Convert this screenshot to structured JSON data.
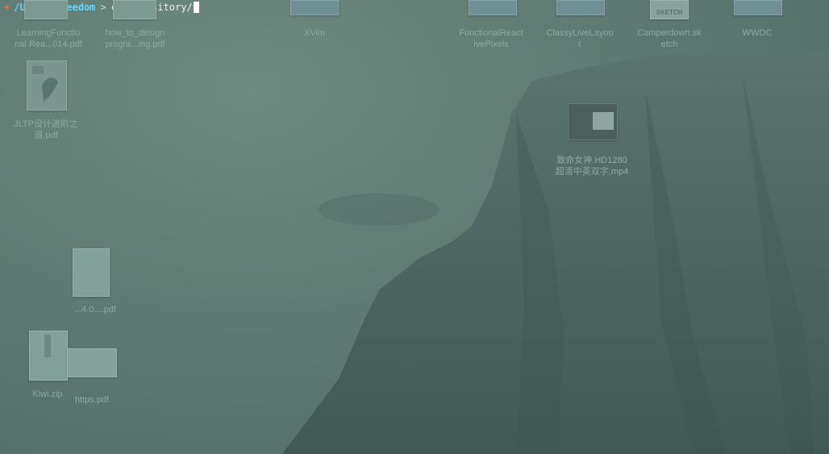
{
  "terminal": {
    "arrow": "➜",
    "path": "/Users/freedom",
    "separator": ">",
    "command": "cd Repository/"
  },
  "desktop_icons": [
    {
      "label": "LearningFunctio\nnal Rea...014.pdf"
    },
    {
      "label": "how_to_design\nprogra...ing.pdf"
    },
    {
      "label": "XVim"
    },
    {
      "label": "FunctionalReact\nivePixels"
    },
    {
      "label": "ClassyLiveLayou\nt"
    },
    {
      "label": "Camperdown.sk\netch",
      "badge": "SKETCH"
    },
    {
      "label": "WWDC"
    },
    {
      "label": "JLTP设计进阶之\n道.pdf"
    },
    {
      "label": "致命女神.HD1280\n超清中英双字.mp4"
    },
    {
      "label": "...4.0....pdf"
    },
    {
      "label": "Kiwi.zip"
    },
    {
      "label": "https.pdf"
    }
  ]
}
